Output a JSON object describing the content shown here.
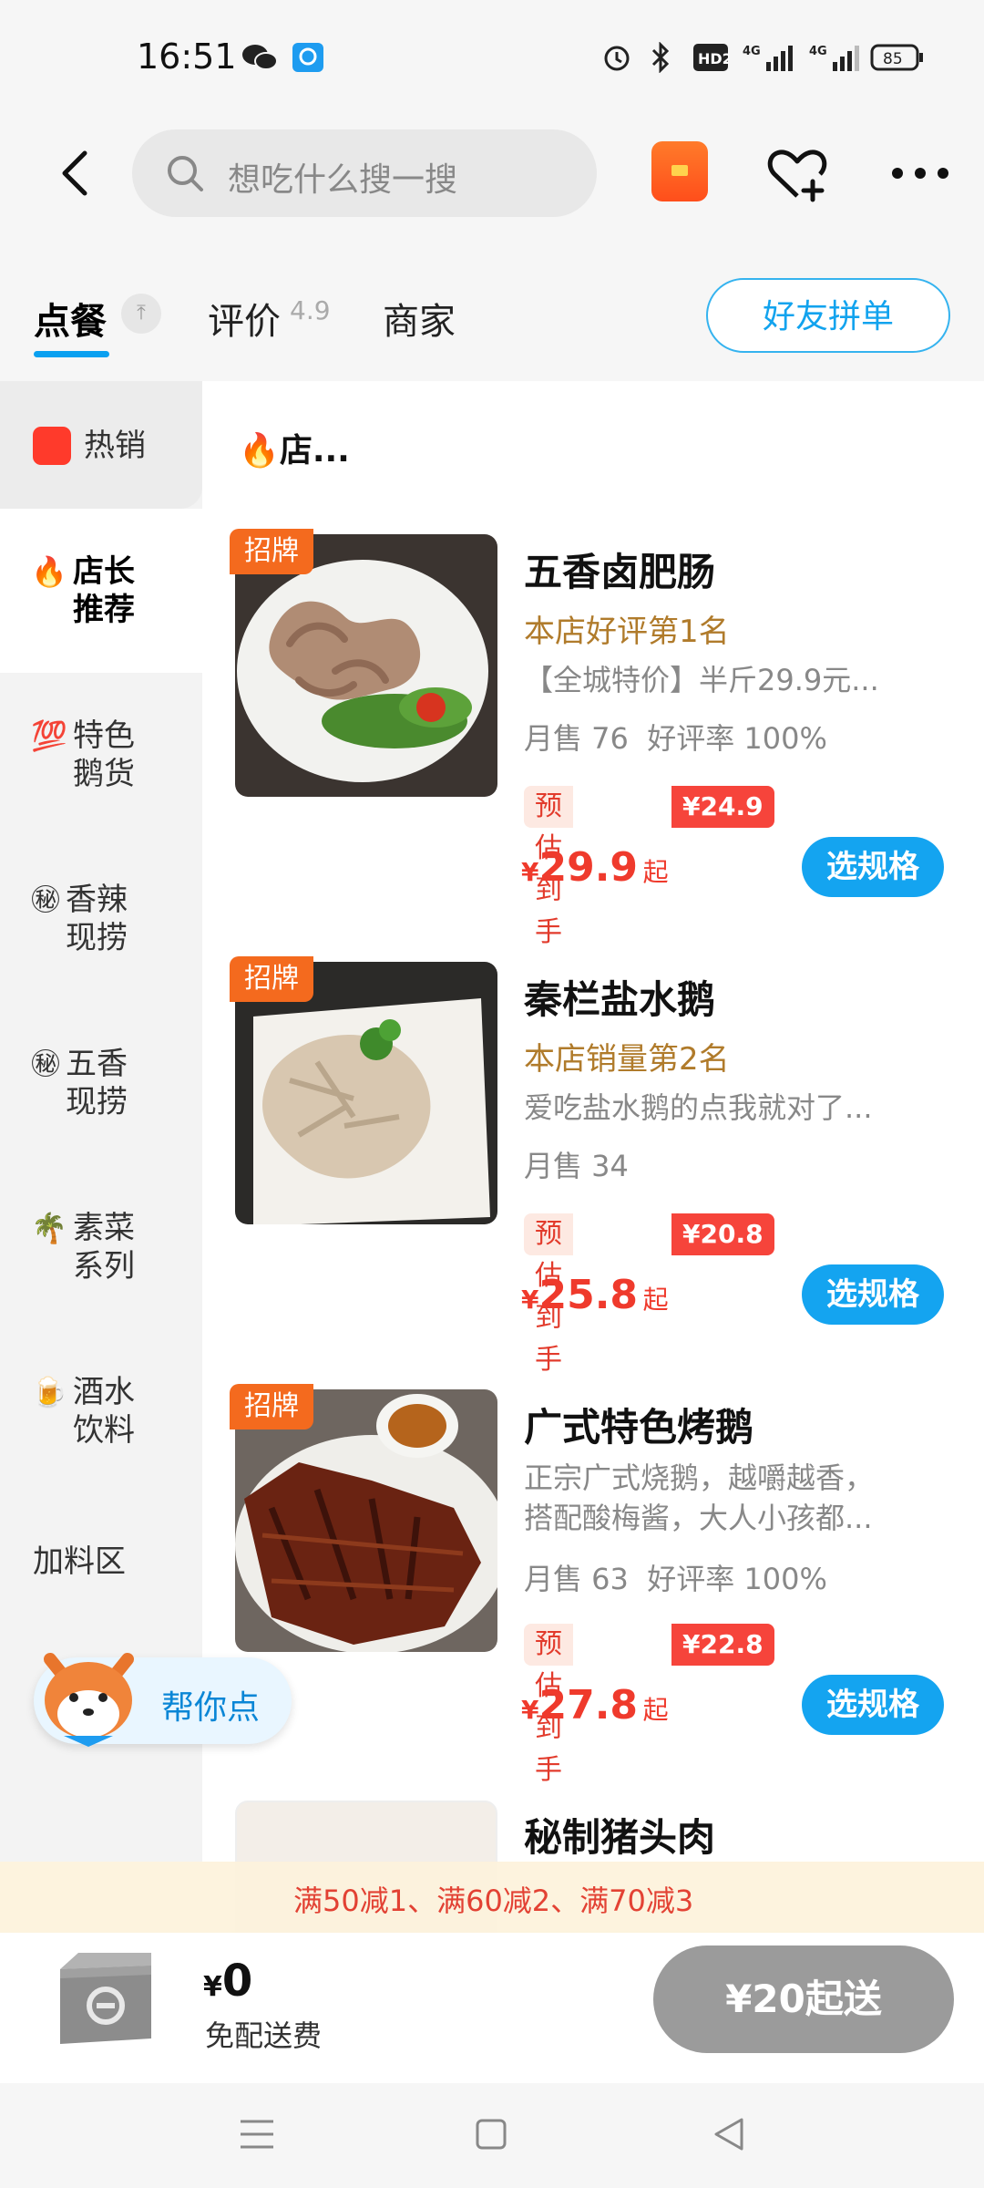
{
  "status_bar": {
    "time": "16:51",
    "hd_label": "HD2",
    "net1": "4G",
    "net2": "4G",
    "battery": "85"
  },
  "header": {
    "search_placeholder": "想吃什么搜一搜"
  },
  "tabs": {
    "order": "点餐",
    "pin_icon": "⤒",
    "review": "评价",
    "rating": "4.9",
    "merchant": "商家",
    "friend_group": "好友拼单"
  },
  "sidebar": {
    "items": [
      {
        "label": "热销"
      },
      {
        "icon": "🔥",
        "line1": "店长",
        "line2": "推荐"
      },
      {
        "icon": "💯",
        "line1": "特色",
        "line2": "鹅货"
      },
      {
        "icon": "㊙",
        "line1": "香辣",
        "line2": "现捞"
      },
      {
        "icon": "㊙",
        "line1": "五香",
        "line2": "现捞"
      },
      {
        "icon": "🌴",
        "line1": "素菜",
        "line2": "系列"
      },
      {
        "icon": "🍺",
        "line1": "酒水",
        "line2": "饮料"
      },
      {
        "label": "加料区"
      }
    ]
  },
  "section": {
    "title": "🔥店..."
  },
  "products": [
    {
      "tag": "招牌",
      "name": "五香卤肥肠",
      "rank": "本店好评第1名",
      "desc": "【全城特价】半斤29.9元...",
      "sales": "月售 76",
      "good_rate": "好评率 100%",
      "est_label": "预估到手",
      "est_price": "¥24.9起",
      "currency": "¥",
      "price": "29.9",
      "qi": "起",
      "button": "选规格"
    },
    {
      "tag": "招牌",
      "name": "秦栏盐水鹅",
      "rank": "本店销量第2名",
      "desc": "爱吃盐水鹅的点我就对了...",
      "sales": "月售 34",
      "est_label": "预估到手",
      "est_price": "¥20.8起",
      "currency": "¥",
      "price": "25.8",
      "qi": "起",
      "button": "选规格"
    },
    {
      "tag": "招牌",
      "name": "广式特色烤鹅",
      "desc1": "正宗广式烧鹅，越嚼越香，",
      "desc2": "搭配酸梅酱，大人小孩都...",
      "sales": "月售 63",
      "good_rate": "好评率 100%",
      "est_label": "预估到手",
      "est_price": "¥22.8起",
      "currency": "¥",
      "price": "27.8",
      "qi": "起",
      "button": "选规格"
    },
    {
      "name": "秘制猪头肉"
    }
  ],
  "promo": {
    "text": "满50减1、满60减2、满70减3"
  },
  "helper": {
    "label": "帮你点"
  },
  "footer": {
    "currency": "¥",
    "total": "0",
    "delivery": "免配送费",
    "min_order_button": "¥20起送"
  }
}
